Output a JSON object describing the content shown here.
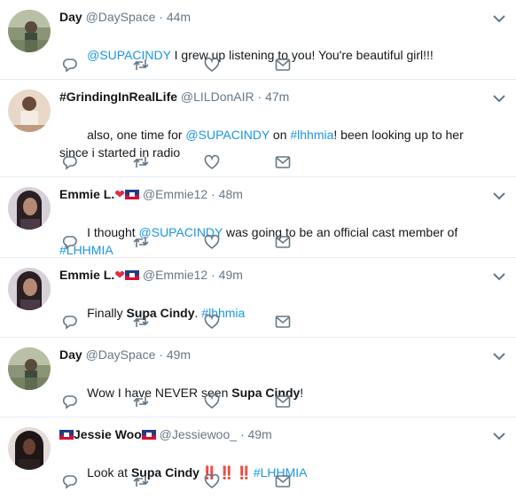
{
  "tweets": [
    {
      "name": "Day",
      "handle": "@DaySpace",
      "time": "44m",
      "text": [
        {
          "t": "@SUPACINDY",
          "c": "link"
        },
        {
          "t": " I grew up listening to you! You're beautiful girl!!!",
          "c": ""
        }
      ],
      "avatar_bg": "#7c8a6a"
    },
    {
      "name": "#GrindingInRealLife",
      "handle": "@LILDonAIR",
      "time": "47m",
      "text": [
        {
          "t": "also, one time for ",
          "c": ""
        },
        {
          "t": "@SUPACINDY",
          "c": "link"
        },
        {
          "t": " on ",
          "c": ""
        },
        {
          "t": "#lhhmia",
          "c": "link"
        },
        {
          "t": "! been looking up to her since i started in radio",
          "c": ""
        }
      ],
      "avatar_bg": "#c9a58a"
    },
    {
      "name": "Emmie L.",
      "handle": "@Emmie12",
      "time": "48m",
      "text": [
        {
          "t": "I thought ",
          "c": ""
        },
        {
          "t": "@SUPACINDY",
          "c": "link"
        },
        {
          "t": " was going to be an official cast member of ",
          "c": ""
        },
        {
          "t": "#LHHMIA",
          "c": "link"
        }
      ],
      "avatar_bg": "#6a5a6e"
    },
    {
      "name": "Emmie L.",
      "handle": "@Emmie12",
      "time": "49m",
      "text": [
        {
          "t": "Finally ",
          "c": ""
        },
        {
          "t": "Supa Cindy",
          "c": "bold"
        },
        {
          "t": ". ",
          "c": ""
        },
        {
          "t": "#lhhmia",
          "c": "link"
        }
      ],
      "avatar_bg": "#6a5a6e"
    },
    {
      "name": "Day",
      "handle": "@DaySpace",
      "time": "49m",
      "text": [
        {
          "t": "Wow I have NEVER seen ",
          "c": ""
        },
        {
          "t": "Supa Cindy",
          "c": "bold"
        },
        {
          "t": "!",
          "c": ""
        }
      ],
      "avatar_bg": "#7c8a6a"
    },
    {
      "name": "Jessie Woo",
      "handle": "@Jessiewoo_",
      "time": "49m",
      "text": [
        {
          "t": "Look at ",
          "c": ""
        },
        {
          "t": "Supa Cindy",
          "c": "bold"
        },
        {
          "t": " ‼️ ‼️ ‼️ ",
          "c": "bang"
        },
        {
          "t": "#LHHMIA",
          "c": "link"
        }
      ],
      "avatar_bg": "#3a3030"
    }
  ],
  "separator": "·",
  "icons": {
    "reply": "reply-icon",
    "retweet": "retweet-icon",
    "like": "heart-icon",
    "dm": "envelope-icon",
    "more": "chevron-down-icon"
  },
  "colors": {
    "link": "#1b95e0",
    "muted": "#657786",
    "icon": "#657786",
    "divider": "#e6ecf0"
  }
}
